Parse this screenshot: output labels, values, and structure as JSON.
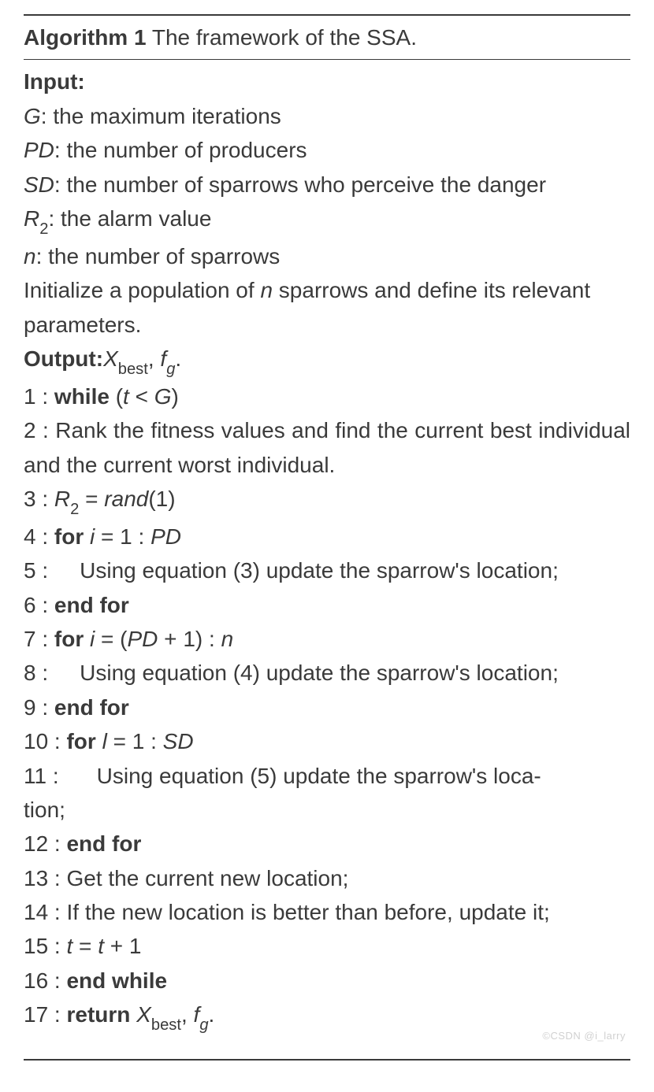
{
  "title": {
    "label": "Algorithm 1",
    "desc": "The framework of the SSA."
  },
  "input": {
    "heading": "Input:",
    "params": [
      {
        "sym": "G",
        "sub": "",
        "desc": ": the maximum iterations"
      },
      {
        "sym": "PD",
        "sub": "",
        "desc": ": the number of producers"
      },
      {
        "sym": "SD",
        "sub": "",
        "desc": ": the number of sparrows who perceive the danger"
      },
      {
        "sym": "R",
        "sub": "2",
        "desc": ": the alarm value"
      },
      {
        "sym": "n",
        "sub": "",
        "desc": ":  the number of sparrows"
      }
    ],
    "init_a": "Initialize a population of ",
    "init_sym": "n",
    "init_b": " sparrows and define its relevant",
    "init_c": "parameters."
  },
  "output": {
    "heading": "Output:",
    "x": "X",
    "xsub": "best",
    "sep": ", ",
    "f": "f",
    "fsub": "g",
    "period": "."
  },
  "steps": {
    "l1": {
      "n": "1 : ",
      "kw": "while",
      "rest": " (t < G)",
      "t": "t",
      "lt": " < ",
      "G": "G"
    },
    "l2": "2 : Rank the fitness values and find the current best individual and the current worst individual.",
    "l3": {
      "n": "3 : ",
      "lhs": "R",
      "sub": "2",
      "eq": " = ",
      "rhs": "rand",
      "paren": "(1)"
    },
    "l4": {
      "n": "4 : ",
      "kw": "for",
      "body": " i = 1 : PD",
      "i": "i",
      "eq": " = 1 : ",
      "PD": "PD"
    },
    "l5": "5 :       Using equation (3) update the sparrow's location;",
    "l6": {
      "n": "6 : ",
      "kw": "end for"
    },
    "l7": {
      "n": "7 : ",
      "kw": "for",
      "i": "i",
      "eq": " = (",
      "PD": "PD",
      "plus": " + 1) : ",
      "nn": "n"
    },
    "l8": "8 :       Using equation (4) update the sparrow's location;",
    "l9": {
      "n": "9 : ",
      "kw": "end for"
    },
    "l10": {
      "n": "10 : ",
      "kw": "for",
      "l": "l",
      "eq": " = 1 : ",
      "SD": "SD"
    },
    "l11a": "11 :      Using equation (5) update the sparrow's loca-",
    "l11b": "tion;",
    "l12": {
      "n": "12 : ",
      "kw": "end for"
    },
    "l13": "13 : Get the current new location;",
    "l14": "14 : If the new location is better than before, update it;",
    "l15": {
      "n": "15 : ",
      "t": "t",
      "eq": " = ",
      "t2": "t",
      "plus": " + 1"
    },
    "l16": {
      "n": "16 : ",
      "kw": "end while"
    },
    "l17": {
      "n": "17 : ",
      "kw": "return ",
      "x": "X",
      "xsub": "best",
      "sep": ", ",
      "f": "f",
      "fsub": "g",
      "period": "."
    }
  },
  "watermark": "©CSDN @i_larry"
}
